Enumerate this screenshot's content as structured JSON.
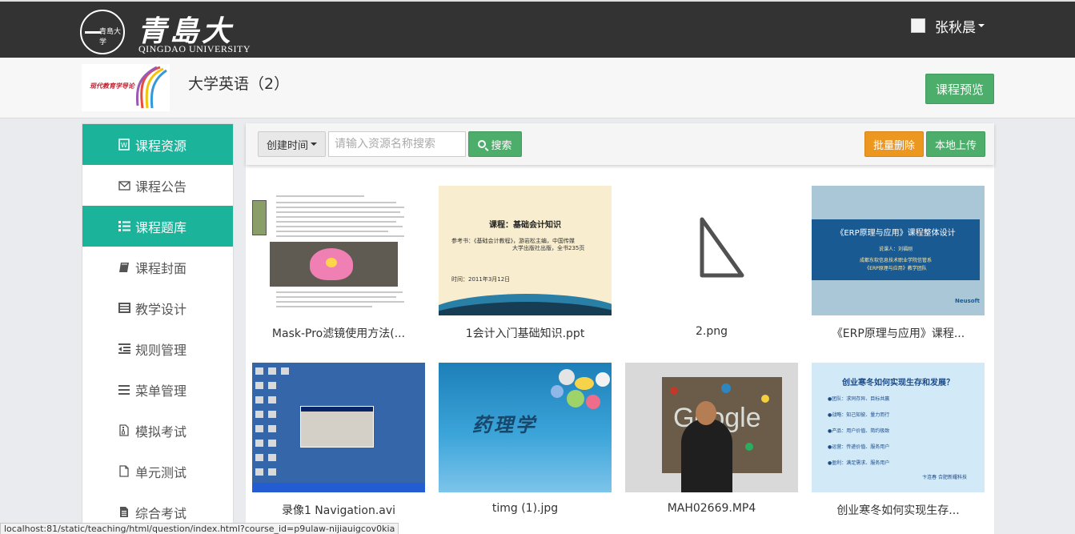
{
  "header": {
    "logo_cn": "青島大学",
    "logo_en": "QINGDAO UNIVERSITY",
    "user_name": "张秋晨"
  },
  "course": {
    "title": "大学英语（2）",
    "preview_label": "课程预览"
  },
  "sidebar": {
    "items": [
      {
        "label": "课程资源",
        "icon": "word-file-icon",
        "active": true
      },
      {
        "label": "课程公告",
        "icon": "envelope-icon",
        "active": false
      },
      {
        "label": "课程题库",
        "icon": "list-icon",
        "active": true
      },
      {
        "label": "课程封面",
        "icon": "book-icon",
        "active": false
      },
      {
        "label": "教学设计",
        "icon": "list-alt-icon",
        "active": false
      },
      {
        "label": "规则管理",
        "icon": "outdent-icon",
        "active": false
      },
      {
        "label": "菜单管理",
        "icon": "bars-icon",
        "active": false
      },
      {
        "label": "模拟考试",
        "icon": "file-archive-icon",
        "active": false
      },
      {
        "label": "单元测试",
        "icon": "file-icon",
        "active": false
      },
      {
        "label": "综合考试",
        "icon": "file-text-icon",
        "active": false
      }
    ]
  },
  "toolbar": {
    "sort_label": "创建时间",
    "search_placeholder": "请输入资源名称搜索",
    "search_label": "搜索",
    "batch_delete_label": "批量删除",
    "upload_label": "本地上传"
  },
  "resources": [
    {
      "name": "Mask-Pro滤镜使用方法(..."
    },
    {
      "name": "1会计入门基础知识.ppt",
      "thumb_title": "课程：基础会计知识",
      "thumb_line1": "参考书：《基础会计教程》，游岩松主编，中国传媒",
      "thumb_line2": "大学出版社出版，全书235页",
      "thumb_date": "时间：2011年3月12日"
    },
    {
      "name": "2.png"
    },
    {
      "name": "《ERP原理与应用》课程...",
      "thumb_title": "《ERP原理与应用》课程整体设计",
      "thumb_line1": "说课人：刘福刚",
      "thumb_line2": "成都东软信息技术职业学院信管系",
      "thumb_line3": "《ERP原理与应用》教学团队",
      "thumb_brand": "Neusoft"
    },
    {
      "name": "录像1 Navigation.avi"
    },
    {
      "name": "timg (1).jpg",
      "thumb_title": "药理学"
    },
    {
      "name": "MAH02669.MP4",
      "thumb_text": "Google"
    },
    {
      "name": "创业寒冬如何实现生存...",
      "thumb_title": "创业寒冬如何实现生存和发展？",
      "thumb_bullets": [
        "●团队：求同存异、目标共赢",
        "●战略：知己知彼、量力而行",
        "●产品：用户价值、简约极致",
        "●运营：传递价值、服务用户",
        "●盈利：满足需求、服务用户"
      ],
      "thumb_footer": "卞连春 合肥新耀科技"
    }
  ],
  "status_url": "localhost:81/static/teaching/html/question/index.html?course_id=p9ulaw-nijiauigcov0kia",
  "colors": {
    "topbar": "#333333",
    "accent": "#1bb39a",
    "success": "#4cae6a",
    "warning": "#ec971f"
  }
}
